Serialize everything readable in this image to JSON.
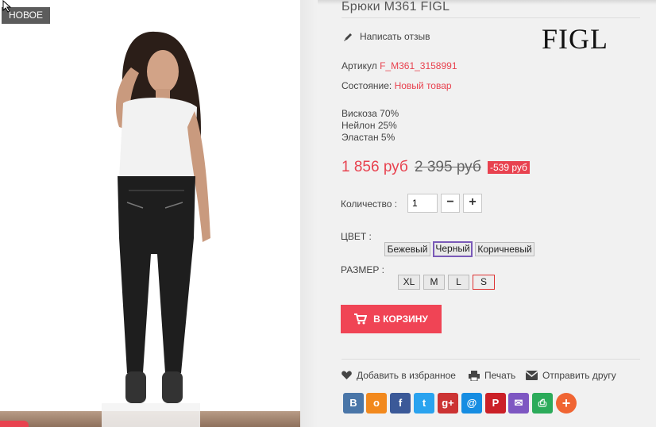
{
  "product": {
    "title": "Брюки M361 FIGL",
    "badge": "НОВОЕ",
    "write_review": "Написать отзыв",
    "brand": "FIGL",
    "sku_label": "Артикул",
    "sku_value": "F_M361_3158991",
    "condition_label": "Состояние:",
    "condition_value": "Новый товар",
    "composition": [
      "Вискоза 70%",
      "Нейлон 25%",
      "Эластан 5%"
    ],
    "price": "1 856 руб",
    "old_price": "2 395 руб",
    "discount": "-539 руб"
  },
  "quantity": {
    "label": "Количество :",
    "value": "1",
    "minus": "−",
    "plus": "+"
  },
  "color": {
    "label": "ЦВЕТ :",
    "options": [
      "Бежевый",
      "Черный",
      "Коричневый"
    ],
    "selected": "Черный"
  },
  "size": {
    "label": "РАЗМЕР :",
    "options": [
      "XL",
      "M",
      "L",
      "S"
    ],
    "selected": "S"
  },
  "cart_button": "В КОРЗИНУ",
  "actions": {
    "favorite": "Добавить в избранное",
    "print": "Печать",
    "send": "Отправить другу"
  },
  "share": [
    {
      "icon": "vk-icon",
      "glyph": "В",
      "color": "#4a76a8"
    },
    {
      "icon": "odnoklassniki-icon",
      "glyph": "о",
      "color": "#f2891d"
    },
    {
      "icon": "facebook-icon",
      "glyph": "f",
      "color": "#3b5998"
    },
    {
      "icon": "twitter-icon",
      "glyph": "t",
      "color": "#2aa3ef"
    },
    {
      "icon": "google-plus-icon",
      "glyph": "g+",
      "color": "#cc3333"
    },
    {
      "icon": "mail-ru-icon",
      "glyph": "@",
      "color": "#168de2"
    },
    {
      "icon": "pinterest-icon",
      "glyph": "P",
      "color": "#cb2027"
    },
    {
      "icon": "email-icon",
      "glyph": "✉",
      "color": "#7e57c2"
    },
    {
      "icon": "print-share-icon",
      "glyph": "⎙",
      "color": "#2cab5a"
    },
    {
      "icon": "more-share-icon",
      "glyph": "+",
      "color": "#f06533"
    }
  ],
  "colors": {
    "accent": "#e8424f",
    "cart": "#f04455",
    "badge": "#5c5c5c"
  }
}
